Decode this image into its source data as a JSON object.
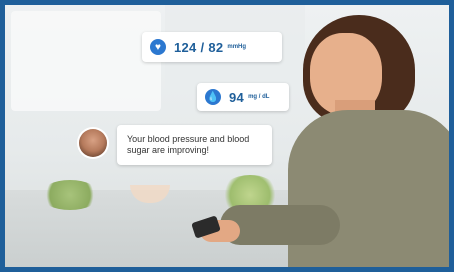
{
  "readings": {
    "blood_pressure": {
      "value": "124 / 82",
      "unit": "mmHg"
    },
    "glucose": {
      "value": "94",
      "unit": "mg / dL"
    }
  },
  "message": {
    "text": "Your blood pressure and blood sugar are improving!"
  },
  "icons": {
    "bp_icon": "heart-icon",
    "glucose_icon": "drop-icon"
  },
  "colors": {
    "accent": "#2c78d0",
    "frame": "#1f5f9a",
    "card": "#ffffff"
  }
}
